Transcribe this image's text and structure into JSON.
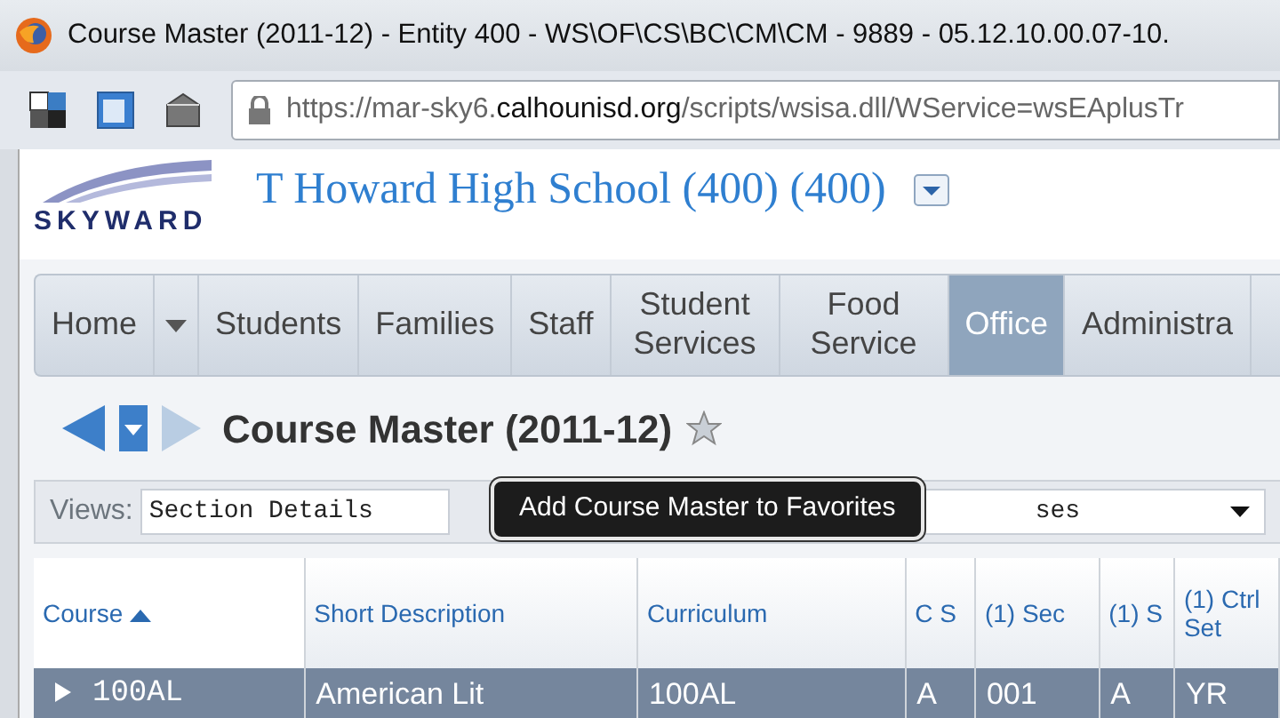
{
  "window": {
    "title": "Course Master (2011-12) - Entity 400 - WS\\OF\\CS\\BC\\CM\\CM - 9889 - 05.12.10.00.07-10."
  },
  "address_bar": {
    "url_prefix": "https://mar-sky6.",
    "url_domain": "calhounisd.org",
    "url_path": "/scripts/wsisa.dll/WService=wsEAplusTr"
  },
  "header": {
    "school": "T Howard High School (400) (400)",
    "logo_text": "SKYWARD"
  },
  "nav": [
    {
      "kind": "link",
      "label": "Home",
      "selected": false
    },
    {
      "kind": "menu",
      "selected": false
    },
    {
      "kind": "link",
      "label": "Students",
      "selected": false
    },
    {
      "kind": "link",
      "label": "Families",
      "selected": false
    },
    {
      "kind": "link",
      "label": "Staff",
      "selected": false
    },
    {
      "kind": "link",
      "label": "Student Services",
      "selected": false
    },
    {
      "kind": "link",
      "label": "Food Service",
      "selected": false
    },
    {
      "kind": "link",
      "label": "Office",
      "selected": true
    },
    {
      "kind": "link",
      "label": "Administra",
      "selected": false
    }
  ],
  "page": {
    "title": "Course Master (2011-12)",
    "tooltip": "Add Course Master to Favorites"
  },
  "views": {
    "label": "Views:",
    "value": "Section Details",
    "filter_value": "ses"
  },
  "table": {
    "columns": [
      {
        "label": "Course",
        "sort_ascending": true
      },
      {
        "label": "Short Description",
        "sort_ascending": false
      },
      {
        "label": "Curriculum",
        "sort_ascending": false
      },
      {
        "label": "C S",
        "sort_ascending": false
      },
      {
        "label": "(1) Sec",
        "sort_ascending": false
      },
      {
        "label": "(1) S",
        "sort_ascending": false
      },
      {
        "label": "(1) Ctrl Set",
        "sort_ascending": false
      }
    ],
    "rows": [
      {
        "selected": true,
        "expanded": false,
        "cells": [
          "100AL",
          "American Lit",
          "100AL",
          "A",
          "001",
          "A",
          "YR"
        ]
      }
    ]
  }
}
